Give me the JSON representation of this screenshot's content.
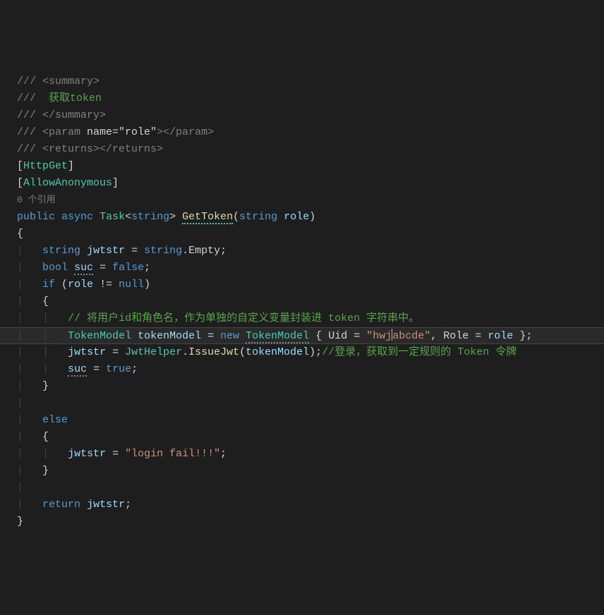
{
  "code": {
    "l1_doc": "/// ",
    "l1_tag_open": "<summary>",
    "l2_doc": "///  ",
    "l2_text": "获取token",
    "l3_doc": "/// ",
    "l3_tag_close": "</summary>",
    "l4_doc": "/// ",
    "l4_open": "<param ",
    "l4_attr": "name=\"role\"",
    "l4_close": "></param>",
    "l5_doc": "/// ",
    "l5_open": "<returns>",
    "l5_close": "</returns>",
    "l6_bracket_open": "[",
    "l6_attr": "HttpGet",
    "l6_bracket_close": "]",
    "l7_bracket_open": "[",
    "l7_attr": "AllowAnonymous",
    "l7_bracket_close": "]",
    "l8_codelens": "0 个引用",
    "l9_public": "public",
    "l9_async": "async",
    "l9_task": "Task",
    "l9_lt": "<",
    "l9_string": "string",
    "l9_gt": "> ",
    "l9_method": "GetToken",
    "l9_paren_open": "(",
    "l9_param_type": "string",
    "l9_param_name": "role",
    "l9_paren_close": ")",
    "l10_brace": "{",
    "l11_type": "string",
    "l11_var": "jwtstr",
    "l11_eq": " = ",
    "l11_string_kw": "string",
    "l11_dot": ".",
    "l11_empty": "Empty",
    "l11_semi": ";",
    "l12_type": "bool",
    "l12_var": "suc",
    "l12_eq": " = ",
    "l12_false": "false",
    "l12_semi": ";",
    "l13_if": "if",
    "l13_paren_open": " (",
    "l13_var": "role",
    "l13_neq": " != ",
    "l13_null": "null",
    "l13_paren_close": ")",
    "l14_brace": "{",
    "l15_comment": "// 将用户id和角色名，作为单独的自定义变量封装进 token 字符串中。",
    "l16_type1": "TokenModel",
    "l16_var": "tokenModel",
    "l16_eq": " = ",
    "l16_new": "new",
    "l16_type2": "TokenModel",
    "l16_brace_open": " { ",
    "l16_uid": "Uid",
    "l16_eq2": " = ",
    "l16_str": "\"hwj",
    "l16_str_b": "abcde\"",
    "l16_comma": ", ",
    "l16_role": "Role",
    "l16_eq3": " = ",
    "l16_rolevar": "role",
    "l16_brace_close": " };",
    "l17_var": "jwtstr",
    "l17_eq": " = ",
    "l17_class": "JwtHelper",
    "l17_dot": ".",
    "l17_method": "IssueJwt",
    "l17_paren_open": "(",
    "l17_arg": "tokenModel",
    "l17_paren_close": ");",
    "l17_comment": "//登录，获取到一定规则的 Token 令牌",
    "l18_var": "suc",
    "l18_eq": " = ",
    "l18_true": "true",
    "l18_semi": ";",
    "l19_brace": "}",
    "l21_else": "else",
    "l22_brace": "{",
    "l23_var": "jwtstr",
    "l23_eq": " = ",
    "l23_str": "\"login fail!!!\"",
    "l23_semi": ";",
    "l24_brace": "}",
    "l26_return": "return",
    "l26_var": "jwtstr",
    "l26_semi": ";",
    "l27_brace": "}"
  }
}
